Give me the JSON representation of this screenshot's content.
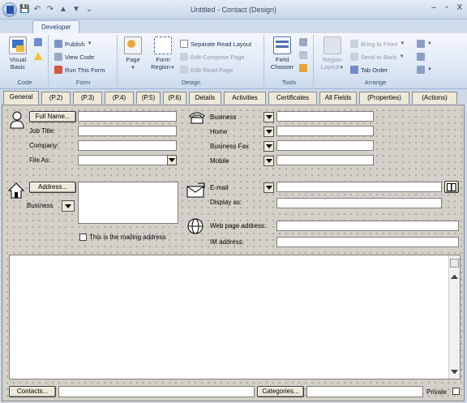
{
  "window": {
    "title": "Untitled - Contact  (Design)",
    "minimize": "–",
    "restore": "▫",
    "close": "X"
  },
  "qat": {
    "save": "💾",
    "undo": "↶",
    "redo": "↷",
    "up": "▲",
    "down": "▼",
    "more": "⌄"
  },
  "ribbon_tab": "Developer",
  "ribbon": {
    "code": {
      "label": "Code",
      "visual_basic": "Visual Basic"
    },
    "form": {
      "label": "Form",
      "publish": "Publish",
      "view_code": "View Code",
      "run_this_form": "Run This Form"
    },
    "design": {
      "label": "Design",
      "page": "Page",
      "form_region": "Form Region",
      "separate_read_layout": "Separate Read Layout",
      "edit_compose_page": "Edit Compose Page",
      "edit_read_page": "Edit Read Page"
    },
    "tools": {
      "label": "Tools",
      "field_chooser": "Field Chooser"
    },
    "arrange": {
      "label": "Arrange",
      "region_layout": "Region Layout",
      "bring_to_front": "Bring to Front",
      "send_to_back": "Send to Back",
      "tab_order": "Tab Order"
    }
  },
  "form_tabs": [
    "General",
    "(P.2)",
    "(P.3)",
    "(P.4)",
    "(P.5)",
    "(P.6)",
    "Details",
    "Activities",
    "Certificates",
    "All Fields",
    "(Properties)",
    "(Actions)"
  ],
  "form": {
    "full_name_btn": "Full Name...",
    "job_title": "Job Title:",
    "company": "Company:",
    "file_as": "File As:",
    "address_btn": "Address...",
    "address_type": "Business",
    "mailing_checkbox": "This is the mailing address",
    "phones": [
      "Business",
      "Home",
      "Business Fax",
      "Mobile"
    ],
    "email": "E-mail",
    "display_as": "Display as:",
    "web_page": "Web page address:",
    "im_address": "IM address:",
    "contacts_btn": "Contacts...",
    "categories_btn": "Categories...",
    "private": "Private"
  }
}
